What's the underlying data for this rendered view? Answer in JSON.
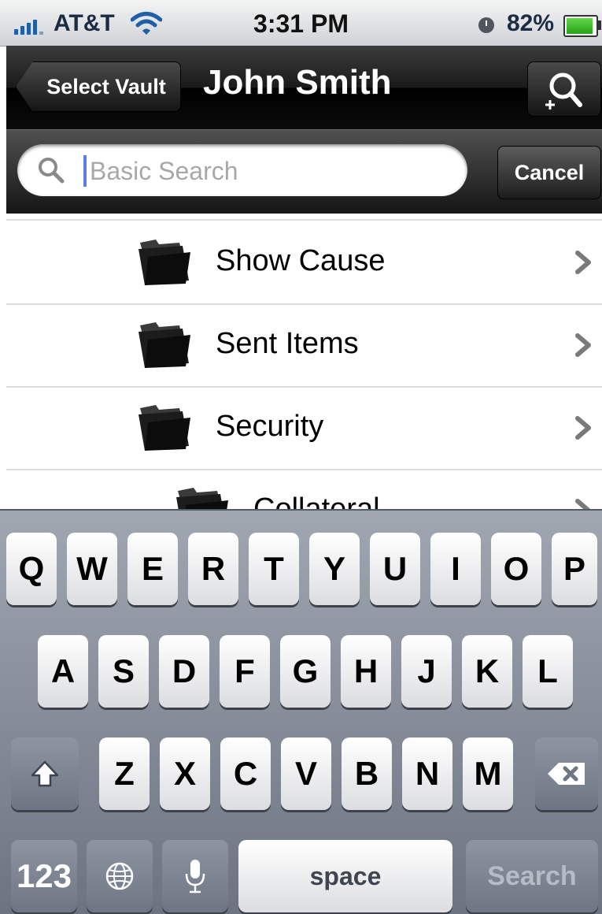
{
  "status_bar": {
    "carrier": "AT&T",
    "time": "3:31 PM",
    "battery_percent": "82%",
    "battery_level": 0.82,
    "icons": [
      "signal-icon",
      "wifi-icon",
      "alarm-icon",
      "battery-icon"
    ]
  },
  "nav": {
    "back_label": "Select Vault",
    "title": "John Smith",
    "action_icon": "search-person-icon"
  },
  "search": {
    "placeholder": "Basic Search",
    "value": "",
    "cancel_label": "Cancel",
    "icon": "search-icon"
  },
  "list": {
    "items": [
      {
        "label": "Show Cause",
        "icon": "folder-icon",
        "indent": 0
      },
      {
        "label": "Sent Items",
        "icon": "folder-icon",
        "indent": 0
      },
      {
        "label": "Security",
        "icon": "folder-icon",
        "indent": 0
      },
      {
        "label": "Collateral",
        "icon": "folder-icon",
        "indent": 1
      }
    ]
  },
  "keyboard": {
    "row1": [
      "Q",
      "W",
      "E",
      "R",
      "T",
      "Y",
      "U",
      "I",
      "O",
      "P"
    ],
    "row2": [
      "A",
      "S",
      "D",
      "F",
      "G",
      "H",
      "J",
      "K",
      "L"
    ],
    "row3": [
      "Z",
      "X",
      "C",
      "V",
      "B",
      "N",
      "M"
    ],
    "numbers_label": "123",
    "space_label": "space",
    "search_label": "Search",
    "special_icons": [
      "shift-icon",
      "backspace-icon",
      "globe-icon",
      "microphone-icon"
    ]
  },
  "colors": {
    "nav_bar": "#000000",
    "caret": "#5a7fe0",
    "keyboard_bg": "#8a919d"
  }
}
